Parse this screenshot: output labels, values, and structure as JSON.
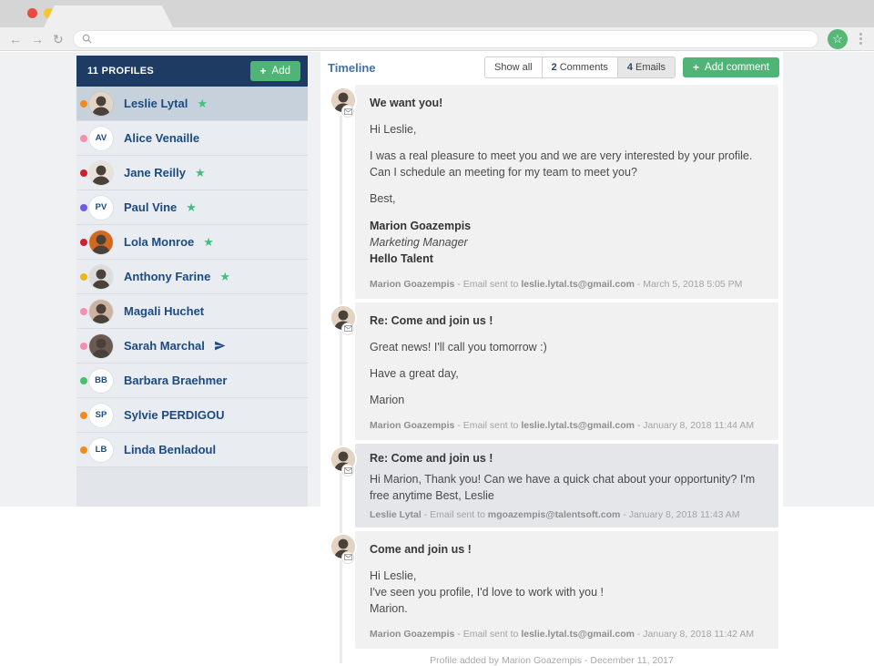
{
  "browser": {
    "tab_title": "",
    "url_value": "",
    "controls": {
      "back": "back",
      "forward": "forward",
      "reload": "reload"
    }
  },
  "colors": {
    "header_navy": "#1d3b63",
    "accent_green": "#4fb476",
    "name_blue": "#1b4b82",
    "star_green": "#3fbf7f",
    "selected_row": "#c7d1db",
    "timeline_blue": "#4272a8"
  },
  "sidebar": {
    "header": {
      "title": "11 PROFILES",
      "add_label": "Add"
    },
    "profiles": [
      {
        "name": "Leslie Lytal",
        "dot_color": "#ef8b1f",
        "avatar": {
          "type": "photo",
          "bg": "#e3d3c3"
        },
        "badge": "star",
        "selected": true
      },
      {
        "name": "Alice Venaille",
        "dot_color": "#f48fb1",
        "avatar": {
          "type": "initials",
          "initials": "AV"
        },
        "badge": "none",
        "selected": false
      },
      {
        "name": "Jane Reilly",
        "dot_color": "#cf2030",
        "avatar": {
          "type": "photo",
          "bg": "#e9e2da"
        },
        "badge": "star",
        "selected": false
      },
      {
        "name": "Paul Vine",
        "dot_color": "#6c5ce7",
        "avatar": {
          "type": "initials",
          "initials": "PV"
        },
        "badge": "star",
        "selected": false
      },
      {
        "name": "Lola Monroe",
        "dot_color": "#cf2030",
        "avatar": {
          "type": "photo",
          "bg": "#d2691e"
        },
        "badge": "star",
        "selected": false
      },
      {
        "name": "Anthony Farine",
        "dot_color": "#eab71e",
        "avatar": {
          "type": "photo",
          "bg": "#dcdcdc"
        },
        "badge": "star",
        "selected": false
      },
      {
        "name": "Magali Huchet",
        "dot_color": "#f48fb1",
        "avatar": {
          "type": "photo",
          "bg": "#cdb2a0"
        },
        "badge": "none",
        "selected": false
      },
      {
        "name": "Sarah Marchal",
        "dot_color": "#f48fb1",
        "avatar": {
          "type": "photo",
          "bg": "#6b5a52"
        },
        "badge": "send",
        "selected": false
      },
      {
        "name": "Barbara Braehmer",
        "dot_color": "#46c06a",
        "avatar": {
          "type": "initials",
          "initials": "BB"
        },
        "badge": "none",
        "selected": false
      },
      {
        "name": "Sylvie PERDIGOU",
        "dot_color": "#ef8b1f",
        "avatar": {
          "type": "initials",
          "initials": "SP"
        },
        "badge": "none",
        "selected": false
      },
      {
        "name": "Linda Benladoul",
        "dot_color": "#ef8b1f",
        "avatar": {
          "type": "initials",
          "initials": "LB"
        },
        "badge": "none",
        "selected": false
      }
    ]
  },
  "timeline": {
    "title": "Timeline",
    "filters": [
      {
        "count": "",
        "label": "Show all",
        "active": false
      },
      {
        "count": "2",
        "label": "Comments",
        "active": false
      },
      {
        "count": "4",
        "label": "Emails",
        "active": true
      }
    ],
    "add_comment_label": "Add comment",
    "entries": [
      {
        "subject": "We want you!",
        "paragraphs": [
          "Hi Leslie,",
          "I was a real pleasure to meet you and we are very interested by your profile. Can I schedule an meeting for my team to meet you?",
          "Best,"
        ],
        "signature": [
          {
            "text": "Marion Goazempis",
            "style": "bold"
          },
          {
            "text": "Marketing Manager",
            "style": "italic"
          },
          {
            "text": "Hello Talent",
            "style": "bold"
          }
        ],
        "tone": "light",
        "compact": false,
        "footer": {
          "author": "Marion Goazempis",
          "action": "Email sent to",
          "email": "leslie.lytal.ts@gmail.com",
          "date": "March 5, 2018 5:05 PM"
        }
      },
      {
        "subject": "Re: Come and join us !",
        "paragraphs": [
          "Great news! I'll call you tomorrow :)",
          "Have a great day,",
          "Marion"
        ],
        "tone": "light",
        "compact": false,
        "footer": {
          "author": "Marion Goazempis",
          "action": "Email sent to",
          "email": "leslie.lytal.ts@gmail.com",
          "date": "January 8, 2018 11:44 AM"
        }
      },
      {
        "subject": "Re: Come and join us !",
        "paragraphs": [
          "Hi Marion, Thank you! Can we have a quick chat about your opportunity? I'm free anytime Best, Leslie"
        ],
        "tone": "dark",
        "compact": true,
        "footer": {
          "author": "Leslie Lytal",
          "action": "Email sent to",
          "email": "mgoazempis@talentsoft.com",
          "date": "January 8, 2018 11:43 AM"
        }
      },
      {
        "subject": "Come and join us !",
        "paragraphs": [
          "Hi Leslie,\nI've seen you profile, I'd love to work with you !\nMarion."
        ],
        "tone": "light",
        "compact": false,
        "footer": {
          "author": "Marion Goazempis",
          "action": "Email sent to",
          "email": "leslie.lytal.ts@gmail.com",
          "date": "January 8, 2018 11:42 AM"
        }
      }
    ],
    "clipped_event": "Profile added by Marion Goazempis - December 11, 2017"
  }
}
